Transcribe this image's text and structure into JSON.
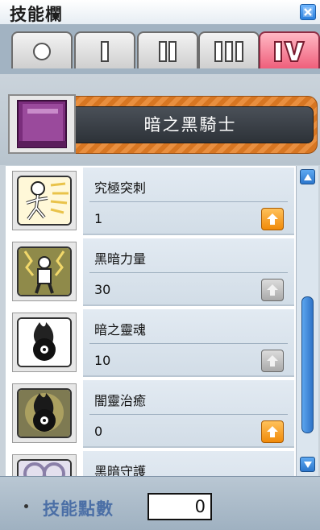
{
  "window": {
    "title": "技能欄",
    "close_icon": "close-icon"
  },
  "tabs": [
    {
      "name": "tab-beginner",
      "glyph": "circle",
      "active": false
    },
    {
      "name": "tab-1st-job",
      "glyph": "I",
      "active": false
    },
    {
      "name": "tab-2nd-job",
      "glyph": "II",
      "active": false
    },
    {
      "name": "tab-3rd-job",
      "glyph": "III",
      "active": false
    },
    {
      "name": "tab-4th-job",
      "glyph": "IV",
      "active": true
    }
  ],
  "job": {
    "name": "暗之黑騎士",
    "icon": "purple-book-icon"
  },
  "skills": [
    {
      "name": "究極突刺",
      "level": "1",
      "icon": "dash-figure-icon",
      "upgrade_enabled": true
    },
    {
      "name": "黑暗力量",
      "level": "30",
      "icon": "dark-power-icon",
      "upgrade_enabled": false
    },
    {
      "name": "暗之靈魂",
      "level": "10",
      "icon": "dark-soul-icon",
      "upgrade_enabled": false
    },
    {
      "name": "闇靈治癒",
      "level": "0",
      "icon": "dark-heal-icon",
      "upgrade_enabled": true
    },
    {
      "name": "黑暗守護",
      "level": "",
      "icon": "dark-guard-icon",
      "upgrade_enabled": false
    }
  ],
  "footer": {
    "sp_label": "技能點數",
    "sp_value": "0"
  },
  "colors": {
    "active_tab": "#ef5f7b",
    "upgrade_on": "#f08a0a",
    "job_banner": "#e98f3f",
    "accent_blue": "#2f73c7"
  }
}
